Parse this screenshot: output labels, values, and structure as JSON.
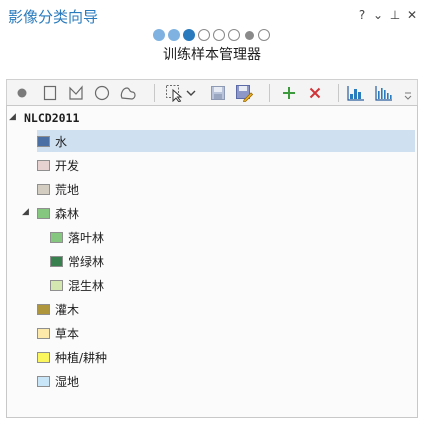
{
  "window": {
    "title": "影像分类向导",
    "controls": {
      "help": "?",
      "menu": "⌄",
      "pin": "⊥",
      "close": "✕"
    }
  },
  "wizard": {
    "step_title": "训练样本管理器",
    "steps": [
      "done",
      "done",
      "current",
      "todo",
      "todo",
      "todo",
      "small",
      "todo"
    ]
  },
  "toolbar": {
    "tools": [
      "point-tool",
      "rectangle-tool",
      "polygon-tool",
      "circle-tool",
      "freehand-tool",
      "select-tool",
      "dropdown-arrow",
      "save-tool",
      "save-as-tool",
      "add-class",
      "remove-class",
      "histogram-tool",
      "scatter-chart-tool"
    ]
  },
  "tree": {
    "root": "NLCD2011",
    "items": [
      {
        "label": "水",
        "color": "#4a6fa5",
        "level": 1,
        "selected": true
      },
      {
        "label": "开发",
        "color": "#e8d1d1",
        "level": 1
      },
      {
        "label": "荒地",
        "color": "#d2cdc0",
        "level": 1
      },
      {
        "label": "森林",
        "color": "#85c77e",
        "level": 1,
        "expanded": true
      },
      {
        "label": "落叶林",
        "color": "#85c77e",
        "level": 2
      },
      {
        "label": "常绿林",
        "color": "#38814e",
        "level": 2
      },
      {
        "label": "混生林",
        "color": "#d4e7b0",
        "level": 2
      },
      {
        "label": "灌木",
        "color": "#af963c",
        "level": 1
      },
      {
        "label": "草本",
        "color": "#fde9aa",
        "level": 1
      },
      {
        "label": "种植/耕种",
        "color": "#fbf65d",
        "level": 1
      },
      {
        "label": "湿地",
        "color": "#c8e6f8",
        "level": 1
      }
    ]
  },
  "colors": {
    "title": "#2a7bbd",
    "selected_row": "#cfe0f1",
    "add_icon": "#3c9a3c",
    "remove_icon": "#d13438"
  }
}
